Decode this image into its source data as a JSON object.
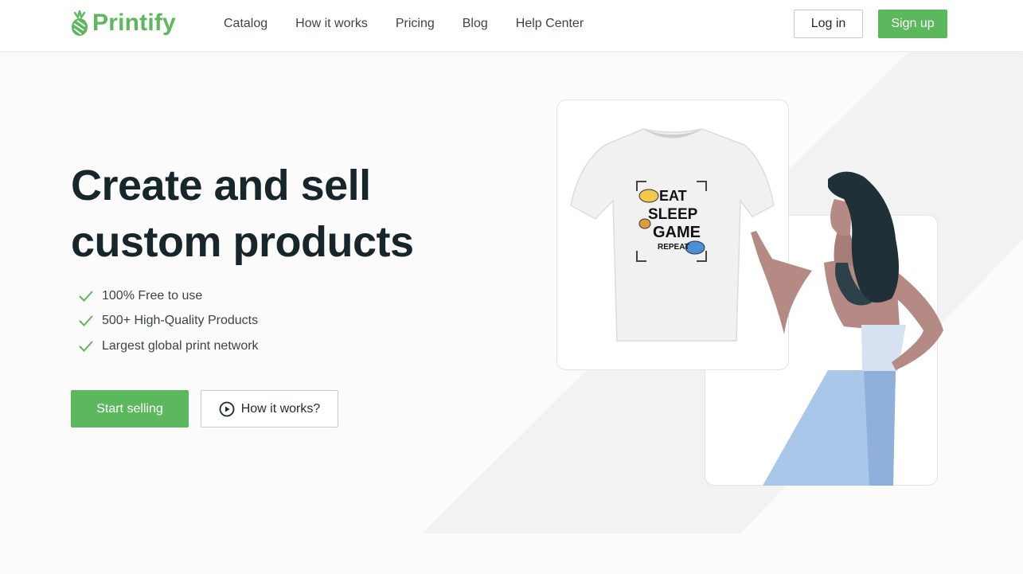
{
  "brand": {
    "name": "Printify",
    "color": "#5cb85c"
  },
  "nav": {
    "items": [
      {
        "label": "Catalog"
      },
      {
        "label": "How it works"
      },
      {
        "label": "Pricing"
      },
      {
        "label": "Blog"
      },
      {
        "label": "Help Center"
      }
    ]
  },
  "auth": {
    "login_label": "Log in",
    "signup_label": "Sign up"
  },
  "hero": {
    "headline_line1": "Create and sell",
    "headline_line2": "custom products",
    "features": [
      {
        "text": "100% Free to use"
      },
      {
        "text": "500+ High-Quality Products"
      },
      {
        "text": "Largest global print network"
      }
    ],
    "cta_primary": "Start selling",
    "cta_secondary": "How it works?"
  },
  "shirt_print": {
    "line1": "EAT",
    "line2": "SLEEP",
    "line3": "GAME",
    "line4": "REPEAT"
  },
  "icons": [
    "pineapple-logo-icon",
    "check-icon",
    "play-circle-icon"
  ]
}
